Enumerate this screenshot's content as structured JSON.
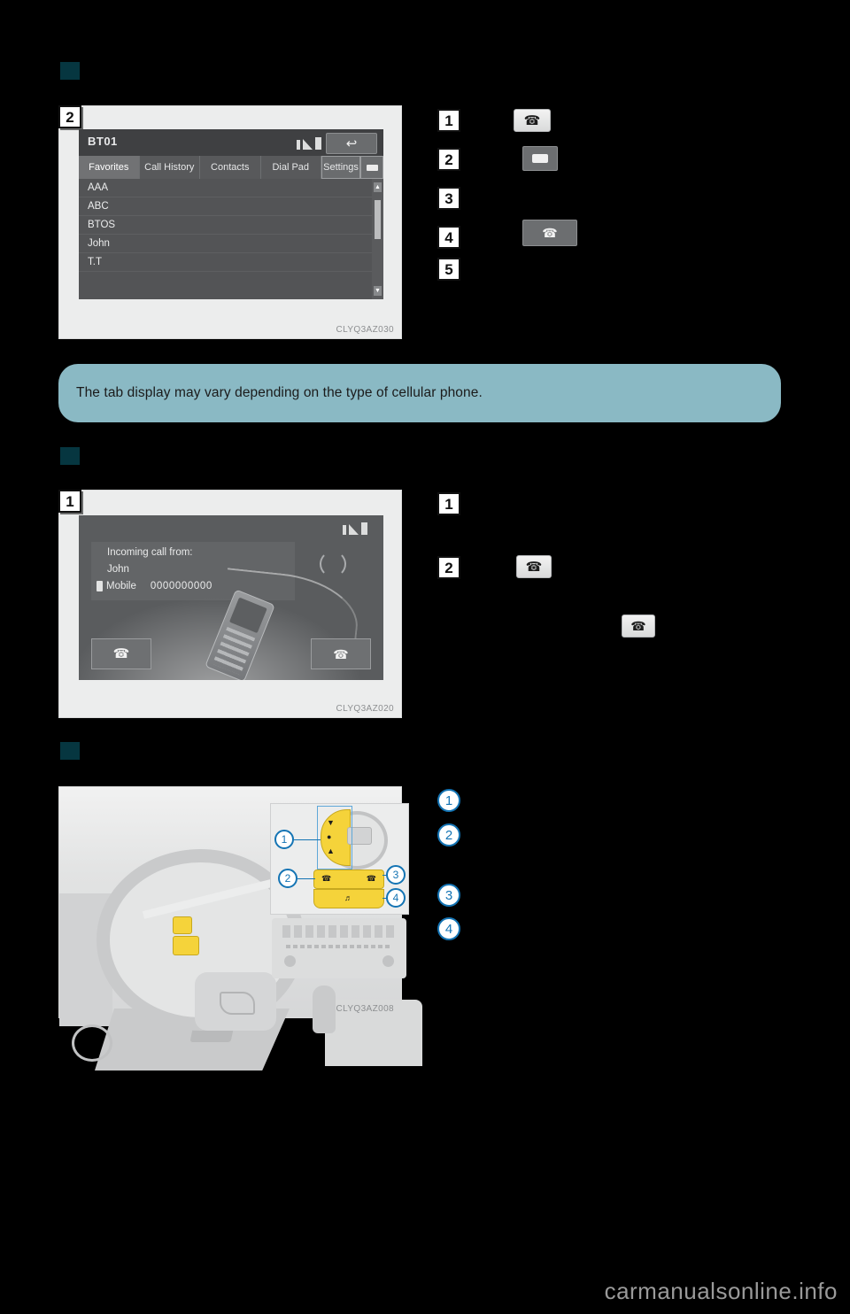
{
  "page": {
    "background_color": "#000000",
    "watermark": "carmanualsonline.info",
    "accent_teal": "#063640",
    "banner_color": "#8ab9c4",
    "callout_blue": "#1474b4"
  },
  "sections": [
    {
      "id": "phone-list",
      "marker_color": "#063640"
    },
    {
      "id": "incoming-call",
      "marker_color": "#063640"
    },
    {
      "id": "steering-switches",
      "marker_color": "#063640"
    }
  ],
  "figure1": {
    "badge": "2",
    "code": "CLYQ3AZ030",
    "screen": {
      "device_name": "BT01",
      "status_icons": [
        "bluetooth-icon",
        "signal-icon",
        "battery-icon"
      ],
      "back_button": "back-arrow-icon",
      "tabs": [
        {
          "label": "Favorites",
          "active": true
        },
        {
          "label": "Call History",
          "active": false
        },
        {
          "label": "Contacts",
          "active": false
        },
        {
          "label": "Dial Pad",
          "active": false
        },
        {
          "label": "Settings",
          "active": false
        }
      ],
      "extra_button": "display-off-icon",
      "list_items": [
        "AAA",
        "ABC",
        "BTOS",
        "John",
        "T.T"
      ],
      "scroll_up": "▲",
      "scroll_down": "▼"
    },
    "callouts": [
      {
        "number": "1",
        "icon": "offhook-phone-key-icon",
        "icon_style": "light-key"
      },
      {
        "number": "2",
        "icon": "display-off-button-icon",
        "icon_style": "dark-key"
      },
      {
        "number": "3",
        "icon": "",
        "icon_style": ""
      },
      {
        "number": "4",
        "icon": "onhook-phone-button-icon",
        "icon_style": "dark-key-wide"
      },
      {
        "number": "5",
        "icon": "",
        "icon_style": ""
      }
    ]
  },
  "banner": {
    "text": "The tab display may vary depending on the type of cellular phone."
  },
  "figure2": {
    "badge": "1",
    "code": "CLYQ3AZ020",
    "screen": {
      "status_icons": [
        "bluetooth-icon",
        "signal-icon",
        "battery-icon"
      ],
      "heading": "Incoming call from:",
      "caller_name": "John",
      "phone_type": "Mobile",
      "phone_number": "0000000000",
      "answer_button": "offhook-phone-icon",
      "decline_button": "onhook-phone-icon"
    },
    "callouts": [
      {
        "number": "1",
        "icon": "",
        "icon_style": ""
      },
      {
        "number": "2",
        "icon": "offhook-phone-key-icon",
        "icon_style": "light-key"
      }
    ],
    "extra_icon": "onhook-phone-key-icon"
  },
  "figure3": {
    "code": "CLYQ3AZ008",
    "inset_callouts": [
      "1",
      "2",
      "3",
      "4"
    ],
    "callouts": [
      {
        "number": "1"
      },
      {
        "number": "2"
      },
      {
        "number": "3"
      },
      {
        "number": "4"
      }
    ]
  },
  "glyphs": {
    "offhook": "☎",
    "onhook": "☎",
    "back": "↩",
    "up": "▴",
    "down": "▾"
  }
}
